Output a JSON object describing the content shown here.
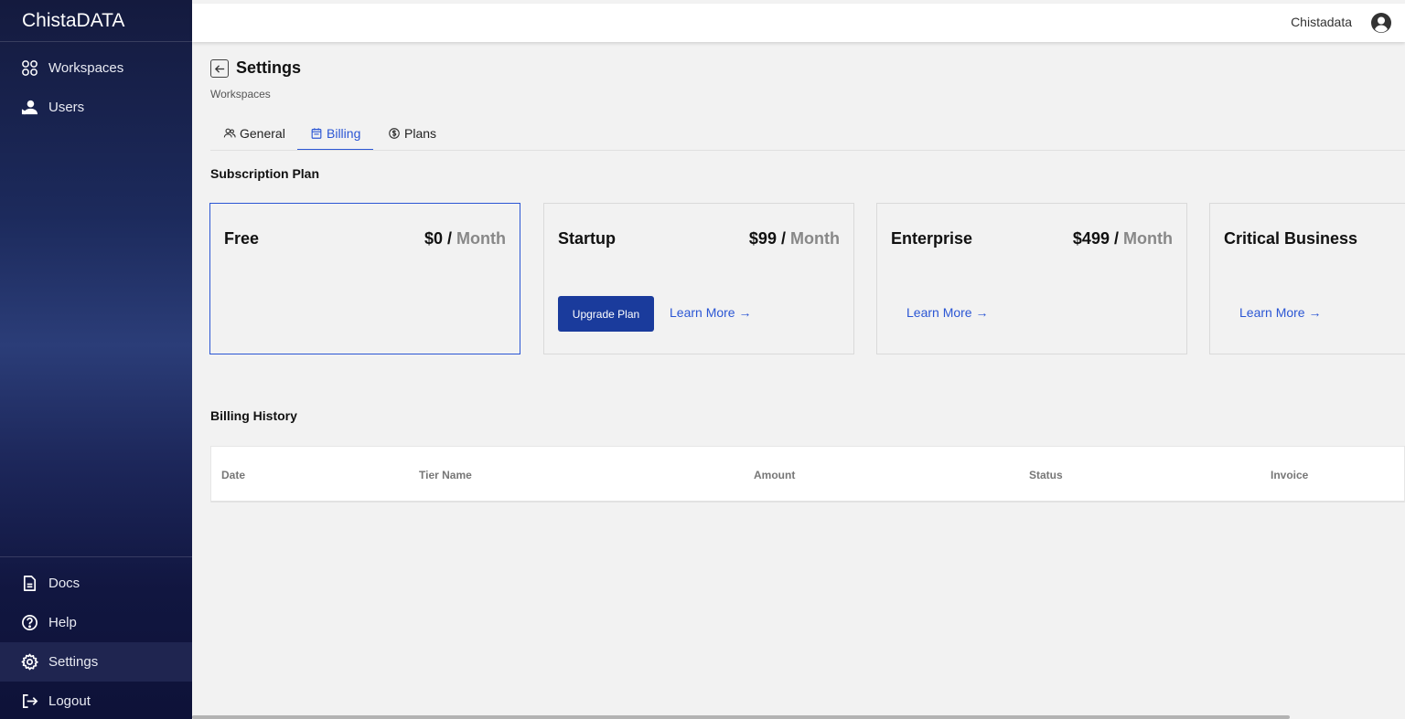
{
  "app": {
    "brand": "ChistaDATA",
    "user_name": "Chistadata"
  },
  "sidebar": {
    "top_items": [
      {
        "label": "Workspaces",
        "icon": "grid-icon"
      },
      {
        "label": "Users",
        "icon": "users-icon"
      }
    ],
    "bottom_items": [
      {
        "label": "Docs",
        "icon": "document-icon"
      },
      {
        "label": "Help",
        "icon": "help-icon"
      },
      {
        "label": "Settings",
        "icon": "gear-icon",
        "active": true
      },
      {
        "label": "Logout",
        "icon": "logout-icon"
      }
    ]
  },
  "page": {
    "title": "Settings",
    "breadcrumb": "Workspaces",
    "tabs": [
      {
        "label": "General",
        "icon": "people-icon"
      },
      {
        "label": "Billing",
        "icon": "calendar-icon",
        "active": true
      },
      {
        "label": "Plans",
        "icon": "dollar-circle-icon"
      }
    ]
  },
  "subscription": {
    "title": "Subscription Plan",
    "plans": [
      {
        "name": "Free",
        "price": "$0",
        "per": "Month",
        "selected": true
      },
      {
        "name": "Startup",
        "price": "$99",
        "per": "Month",
        "upgrade_label": "Upgrade Plan",
        "learn_more": "Learn More →"
      },
      {
        "name": "Enterprise",
        "price": "$499",
        "per": "Month",
        "learn_more": "Learn More →"
      },
      {
        "name": "Critical Business",
        "learn_more": "Learn More →"
      }
    ],
    "slash": "/"
  },
  "billing_history": {
    "title": "Billing History",
    "columns": [
      "Date",
      "Tier Name",
      "Amount",
      "Status",
      "Invoice"
    ]
  },
  "colors": {
    "accent": "#2b56d4",
    "button": "#1a3b9c",
    "sidebar": "#141a3e"
  }
}
